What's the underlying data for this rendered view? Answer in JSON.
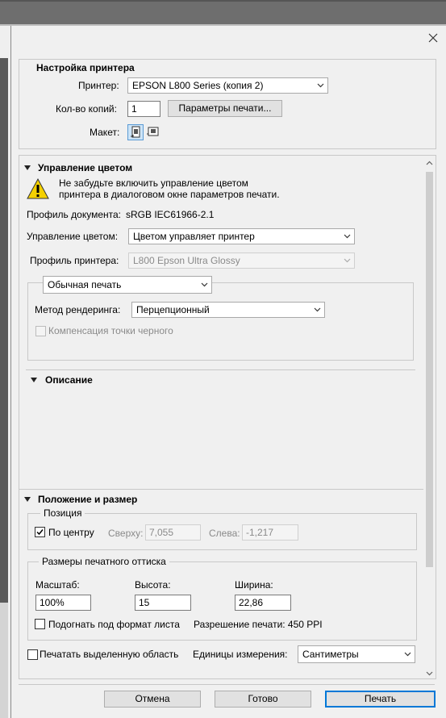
{
  "printer_setup": {
    "title": "Настройка принтера",
    "printer_label": "Принтер:",
    "printer_value": "EPSON L800 Series (копия 2)",
    "copies_label": "Кол-во копий:",
    "copies_value": "1",
    "print_settings_button": "Параметры печати...",
    "layout_label": "Макет:",
    "layout_icons": [
      "portrait-orientation-icon",
      "landscape-orientation-icon"
    ]
  },
  "color_management": {
    "title": "Управление цветом",
    "warning_line1": "Не забудьте включить управление цветом",
    "warning_line2": "принтера в диалоговом окне параметров печати.",
    "doc_profile_label": "Профиль документа:",
    "doc_profile_value": "sRGB IEC61966-2.1",
    "color_handling_label": "Управление цветом:",
    "color_handling_value": "Цветом управляет принтер",
    "printer_profile_label": "Профиль принтера:",
    "printer_profile_value": "L800 Epson Ultra Glossy",
    "print_mode_value": "Обычная печать",
    "rendering_intent_label": "Метод рендеринга:",
    "rendering_intent_value": "Перцепционный",
    "black_point_label": "Компенсация точки черного"
  },
  "description": {
    "title": "Описание"
  },
  "position_size": {
    "title": "Положение и размер",
    "position_group": "Позиция",
    "center_label": "По центру",
    "top_label": "Сверху:",
    "top_value": "7,055",
    "left_label": "Слева:",
    "left_value": "-1,217",
    "scaled_group": "Размеры печатного оттиска",
    "scale_label": "Масштаб:",
    "scale_value": "100%",
    "height_label": "Высота:",
    "height_value": "15",
    "width_label": "Ширина:",
    "width_value": "22,86",
    "fit_media_label": "Подогнать под формат листа",
    "resolution_text": "Разрешение печати: 450 PPI"
  },
  "bottom": {
    "print_selected_label": "Печатать выделенную область",
    "units_label": "Единицы измерения:",
    "units_value": "Сантиметры"
  },
  "buttons": {
    "cancel": "Отмена",
    "done": "Готово",
    "print": "Печать"
  },
  "colors": {
    "accent": "#0078d7",
    "warning": "#f4d000"
  }
}
